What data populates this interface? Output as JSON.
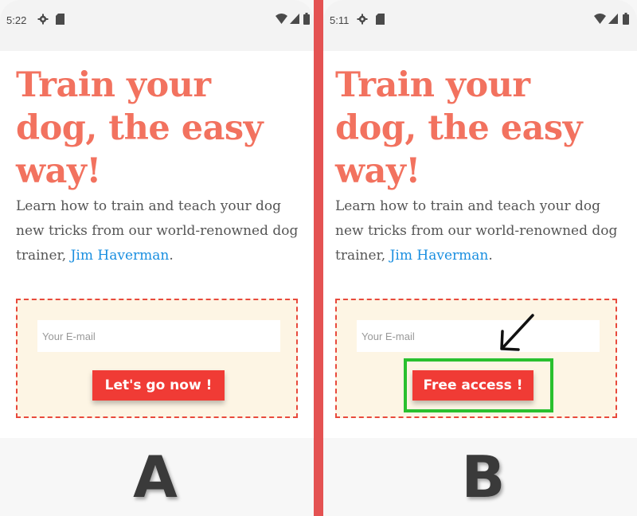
{
  "colors": {
    "headline": "#f2725f",
    "link": "#1a8fe0",
    "button_bg": "#f03b35",
    "form_border": "#e84a3c",
    "form_bg": "#fdf5e4",
    "divider": "#e45252",
    "highlight": "#29c02e"
  },
  "variant_a": {
    "status_time": "5:22",
    "headline": "Train your dog, the easy way!",
    "description": "Learn how to train and teach your dog new tricks from our world-renowned dog trainer, ",
    "trainer_name": "Jim Haverman",
    "trailing_period": ".",
    "email_placeholder": "Your E-mail",
    "button_label": "Let's go now !",
    "label": "A"
  },
  "variant_b": {
    "status_time": "5:11",
    "headline": "Train your dog, the easy way!",
    "description": "Learn how to train and teach your dog new tricks from our world-renowned dog trainer, ",
    "trainer_name": "Jim Haverman",
    "trailing_period": ".",
    "email_placeholder": "Your E-mail",
    "button_label": "Free access !",
    "label": "B"
  },
  "annotation": {
    "icon": "arrow-down-left-icon",
    "highlight": "green-highlight-box"
  }
}
